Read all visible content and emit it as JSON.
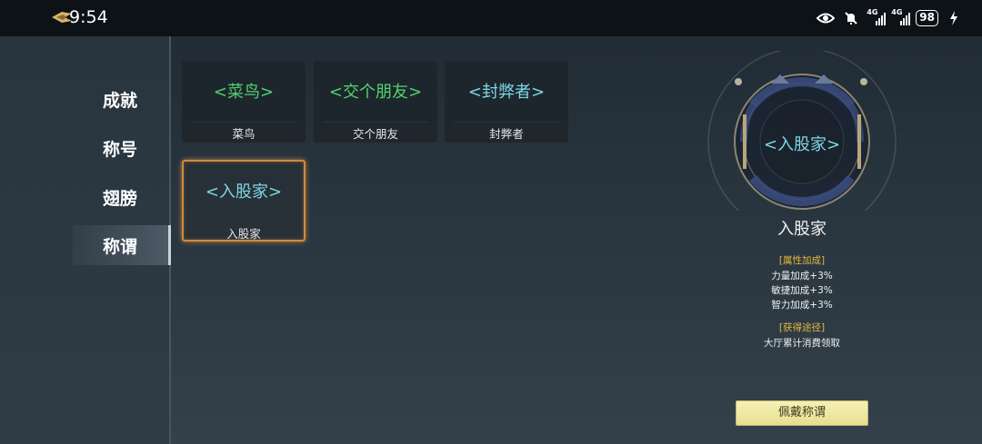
{
  "status_bar": {
    "time": "9:54",
    "network_label_1": "4G",
    "network_label_2": "4G",
    "battery": "98"
  },
  "sidebar": {
    "items": [
      {
        "label": "成就",
        "active": false
      },
      {
        "label": "称号",
        "active": false
      },
      {
        "label": "翅膀",
        "active": false
      },
      {
        "label": "称谓",
        "active": true
      }
    ]
  },
  "titles": [
    {
      "tag": "<菜鸟>",
      "name": "菜鸟",
      "color": "#4fd46d",
      "selected": false
    },
    {
      "tag": "<交个朋友>",
      "name": "交个朋友",
      "color": "#4fd46d",
      "selected": false
    },
    {
      "tag": "<封弊者>",
      "name": "封弊者",
      "color": "#7fd7e4",
      "selected": false
    },
    {
      "tag": "<入股家>",
      "name": "入股家",
      "color": "#7fd7e4",
      "selected": true
    }
  ],
  "detail": {
    "emblem_tag": "<入股家>",
    "name": "入股家",
    "attr_header": "[属性加成]",
    "attrs": [
      "力量加成+3%",
      "敏捷加成+3%",
      "智力加成+3%"
    ],
    "source_header": "[获得途径]",
    "source": "大厅累计消费领取",
    "wear_button": "佩戴称谓"
  },
  "colors": {
    "accent_gold": "#e7b73e",
    "selected_border": "#d08a3c",
    "green_title": "#4fd46d",
    "cyan_title": "#7fd7e4",
    "button_bg": "#f0eaa6"
  }
}
